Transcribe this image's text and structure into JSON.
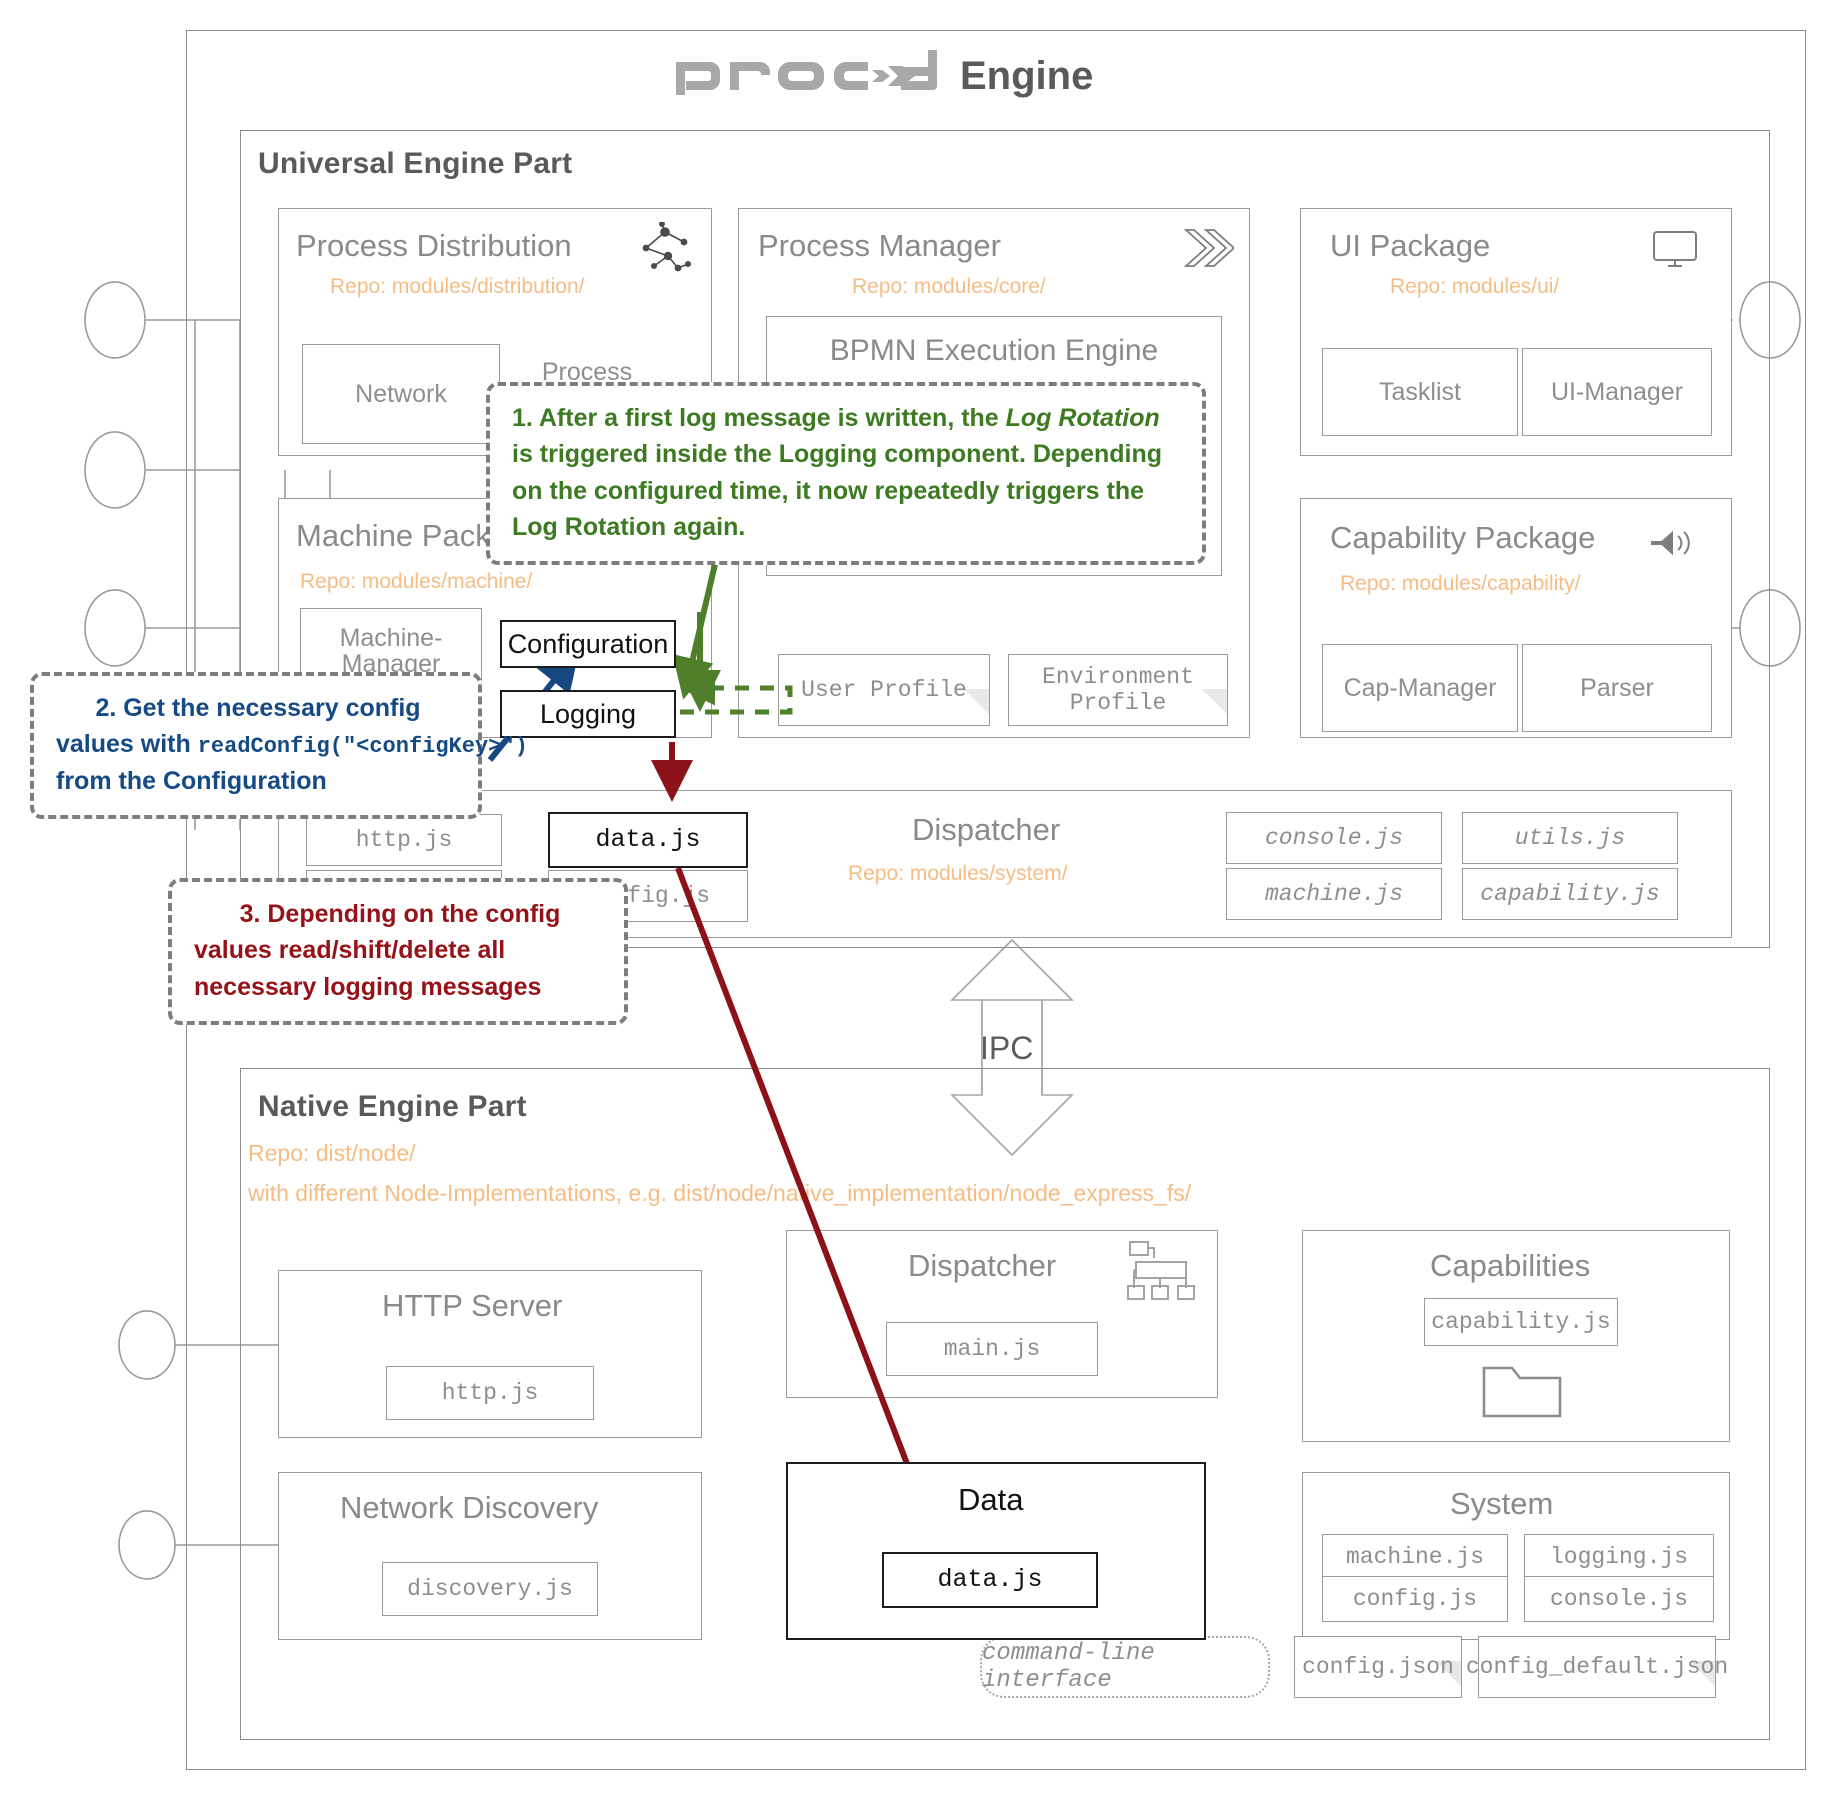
{
  "header": {
    "logo_text": "proc→d",
    "title": "Engine"
  },
  "universal": {
    "title": "Universal Engine Part",
    "cards": [
      {
        "name": "Process Distribution",
        "repo": "Repo: modules/distribution/",
        "icon": "network-nodes-icon",
        "items": [
          "Network",
          "Process"
        ]
      },
      {
        "name": "Process Manager",
        "repo": "Repo: modules/core/",
        "icon": "double-chevron-icon",
        "items": [
          "BPMN Execution Engine",
          "User Profile",
          "Environment Profile"
        ]
      },
      {
        "name": "UI Package",
        "repo": "Repo: modules/ui/",
        "icon": "monitor-icon",
        "items": [
          "Tasklist",
          "UI-Manager"
        ]
      },
      {
        "name": "Machine Package",
        "repo": "Repo: modules/machine/",
        "icon": "",
        "items": [
          "Machine-Manager",
          "Configuration",
          "Logging"
        ]
      },
      {
        "name": "Capability Package",
        "repo": "Repo: modules/capability/",
        "icon": "speaker-icon",
        "items": [
          "Cap-Manager",
          "Parser"
        ]
      }
    ],
    "dispatcher": {
      "name": "Dispatcher",
      "repo": "Repo: modules/system/",
      "files": [
        "http.js",
        "data.js",
        "config.js",
        "console.js",
        "utils.js",
        "machine.js",
        "capability.js"
      ]
    }
  },
  "ipc": {
    "label": "IPC"
  },
  "native": {
    "title": "Native Engine Part",
    "repo_line1": "Repo: dist/node/",
    "repo_line2": "with different Node-Implementations, e.g. dist/node/native_implementation/node_express_fs/",
    "cards": [
      {
        "name": "HTTP Server",
        "files": [
          "http.js"
        ]
      },
      {
        "name": "Dispatcher",
        "icon": "hierarchy-icon",
        "files": [
          "main.js"
        ]
      },
      {
        "name": "Capabilities",
        "icon": "folder-icon",
        "files": [
          "capability.js"
        ]
      },
      {
        "name": "Network Discovery",
        "files": [
          "discovery.js"
        ]
      },
      {
        "name": "Data",
        "icon": "database-icon",
        "files": [
          "data.js"
        ]
      },
      {
        "name": "System",
        "files": [
          "machine.js",
          "logging.js",
          "config.js",
          "console.js"
        ]
      }
    ],
    "cli": "command-line interface",
    "config_files": [
      "config.json",
      "config_default.json"
    ]
  },
  "callouts": [
    {
      "id": 1,
      "color": "#3d7a22",
      "text_parts": [
        "1. After  a first log message is written, the ",
        "Log Rotation",
        " is triggered inside the Logging component. Depending on the configured time, it now repeatedly triggers the Log Rotation again."
      ]
    },
    {
      "id": 2,
      "color": "#154a85",
      "line1": "2. Get the necessary config",
      "line2_pre": "values with ",
      "line2_code": "readConfig(\"<configKey>\")",
      "line3": "from the Configuration"
    },
    {
      "id": 3,
      "color": "#951218",
      "line1": "3. Depending on the config",
      "line2": "values read/shift/delete all",
      "line3": "necessary logging messages"
    }
  ],
  "colors": {
    "green": "#3d7a22",
    "blue": "#154a85",
    "red": "#951218",
    "repo_orange": "#f5bc84",
    "grey_text": "#8a8a8a",
    "border": "#9a9a9a"
  }
}
